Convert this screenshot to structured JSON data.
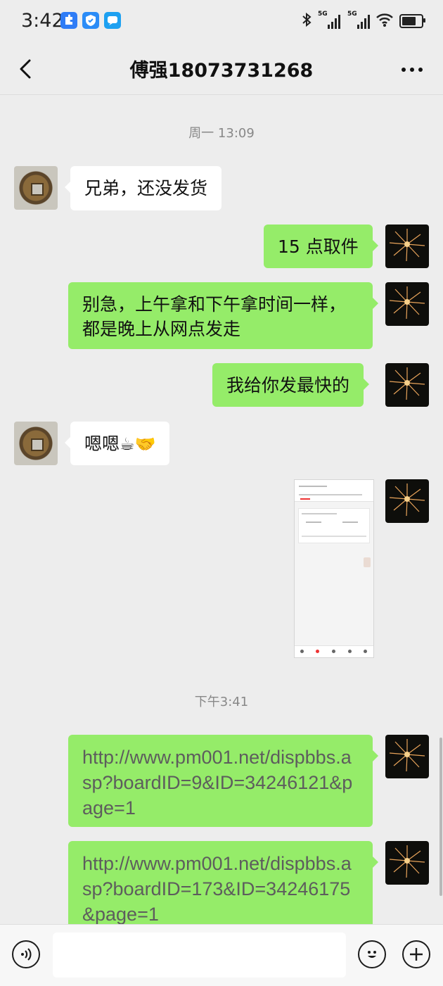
{
  "status_bar": {
    "time": "3:42",
    "network_1": "5G",
    "network_2": "5G",
    "battery_level": 0.85,
    "app_icons": [
      "puzzle-app-icon",
      "shield-app-icon",
      "message-app-icon"
    ]
  },
  "nav": {
    "title": "傅强18073731268"
  },
  "chat": {
    "timestamps": [
      "周一 13:09",
      "下午3:41"
    ],
    "messages": [
      {
        "side": "in",
        "text": "兄弟，还没发货"
      },
      {
        "side": "out",
        "text": "15 点取件"
      },
      {
        "side": "out",
        "line1": "别急，上午拿和下午拿时间一样，",
        "line2": "都是晚上从网点发走"
      },
      {
        "side": "out",
        "text": "我给你发最快的"
      },
      {
        "side": "in",
        "text": "嗯嗯",
        "emoji": "☕🤝"
      },
      {
        "side": "out",
        "type": "image"
      },
      {
        "side": "out",
        "text": "http://www.pm001.net/dispbbs.asp?boardID=9&ID=34246121&page=1"
      },
      {
        "side": "out",
        "text": "http://www.pm001.net/dispbbs.asp?boardID=173&ID=34246175&page=1"
      }
    ]
  },
  "colors": {
    "background": "#ededed",
    "bubble_out": "#95ec69",
    "bubble_in": "#ffffff"
  },
  "input_bar": {
    "placeholder": ""
  }
}
